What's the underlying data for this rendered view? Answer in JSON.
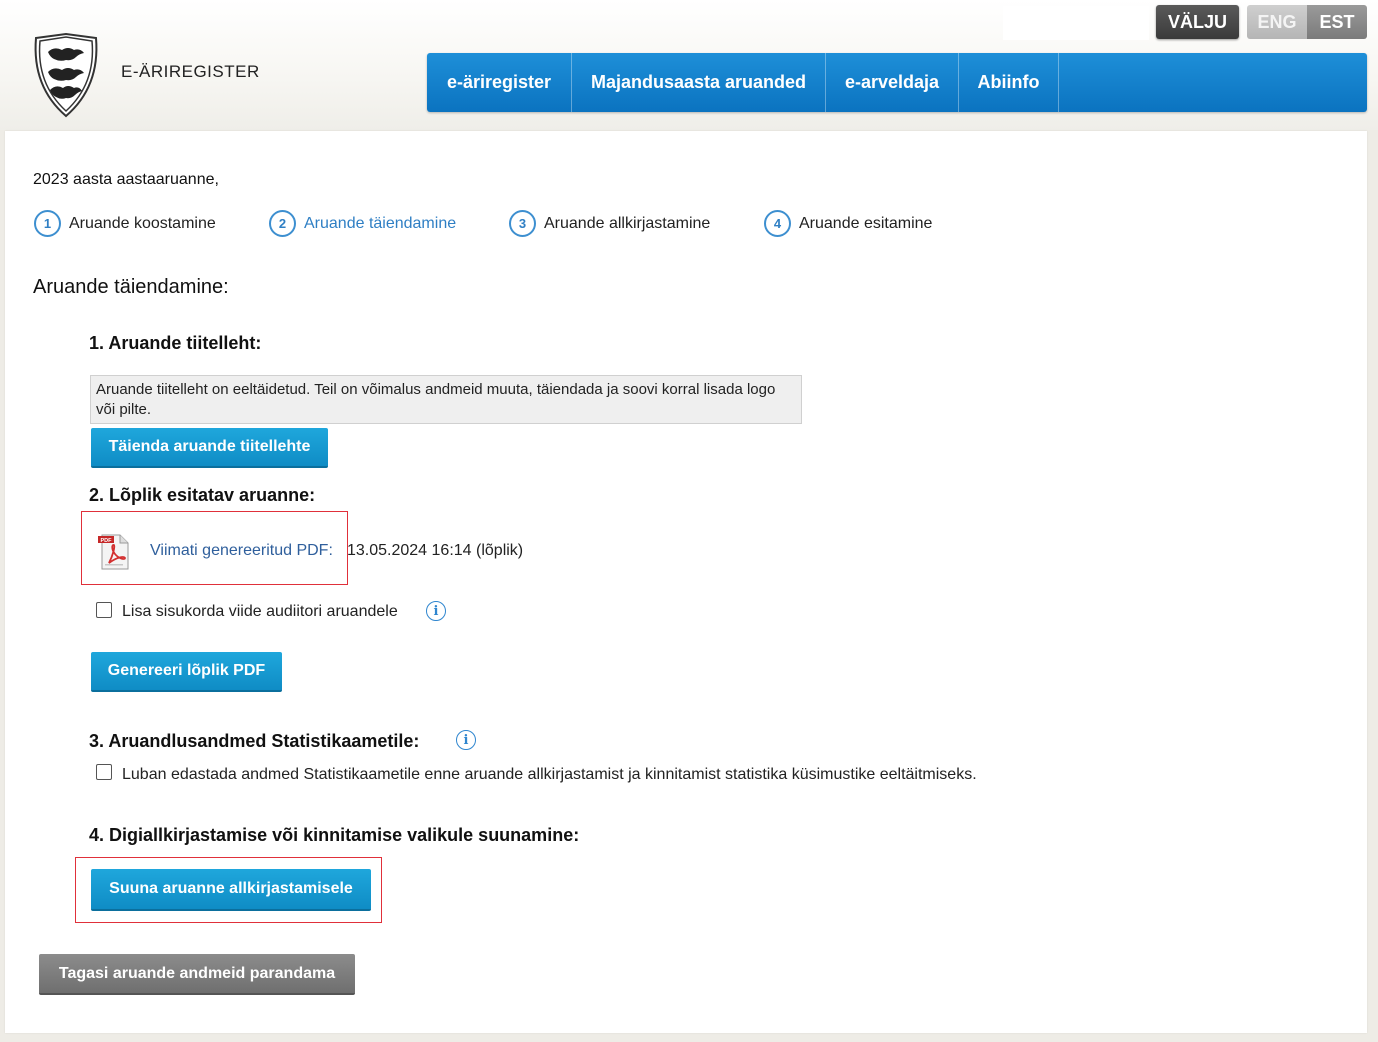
{
  "header": {
    "brand": "E-ÄRIREGISTER",
    "search_placeholder": "",
    "logout_label": "VÄLJU",
    "languages": [
      {
        "label": "ENG",
        "active": false
      },
      {
        "label": "EST",
        "active": true
      }
    ]
  },
  "nav": {
    "items": [
      {
        "label": "e-äriregister"
      },
      {
        "label": "Majandusaasta aruanded"
      },
      {
        "label": "e-arveldaja"
      },
      {
        "label": "Abiinfo"
      }
    ]
  },
  "main": {
    "report_year": "2023 aasta aastaaruanne,",
    "steps": [
      {
        "number": "1",
        "label": "Aruande koostamine",
        "active": false
      },
      {
        "number": "2",
        "label": "Aruande täiendamine",
        "active": true
      },
      {
        "number": "3",
        "label": "Aruande allkirjastamine",
        "active": false
      },
      {
        "number": "4",
        "label": "Aruande esitamine",
        "active": false
      }
    ],
    "section_title": "Aruande täiendamine:",
    "title_page": {
      "heading": "1. Aruande tiitelleht:",
      "info_text": "Aruande tiitelleht on eeltäidetud. Teil on võimalus andmeid muuta, täiendada ja soovi korral lisada logo või pilte.",
      "button_label": "Täienda aruande tiitellehte"
    },
    "final_report": {
      "heading": "2. Lõplik esitatav aruanne:",
      "pdf_icon_text": "PDF",
      "pdf_link_label": "Viimati genereeritud PDF:",
      "pdf_date": "13.05.2024 16:14 (lõplik)",
      "auditor_checkbox_label": "Lisa sisukorda viide audiitori aruandele",
      "auditor_checkbox_checked": false,
      "generate_button_label": "Genereeri lõplik PDF"
    },
    "statistics": {
      "heading": "3. Aruandlusandmed Statistikaametile:",
      "checkbox_label": "Luban edastada andmed Statistikaametile enne aruande allkirjastamist ja kinnitamist statistika küsimustike eeltäitmiseks.",
      "checkbox_checked": false
    },
    "signing": {
      "heading": "4. Digiallkirjastamise või kinnitamise valikule suunamine:",
      "button_label": "Suuna aruanne allkirjastamisele"
    },
    "back_button_label": "Tagasi aruande andmeid parandama"
  },
  "colors": {
    "nav_blue": "#0b73c0",
    "button_blue": "#1fa7dc",
    "highlight_red": "#e0303a",
    "link_blue": "#2f5f9c",
    "step_blue": "#2f7fc4"
  },
  "icons": {
    "logo": "estonia-coat-of-arms",
    "pdf": "pdf-file-icon",
    "info": "info-icon",
    "step": "numbered-circle"
  }
}
